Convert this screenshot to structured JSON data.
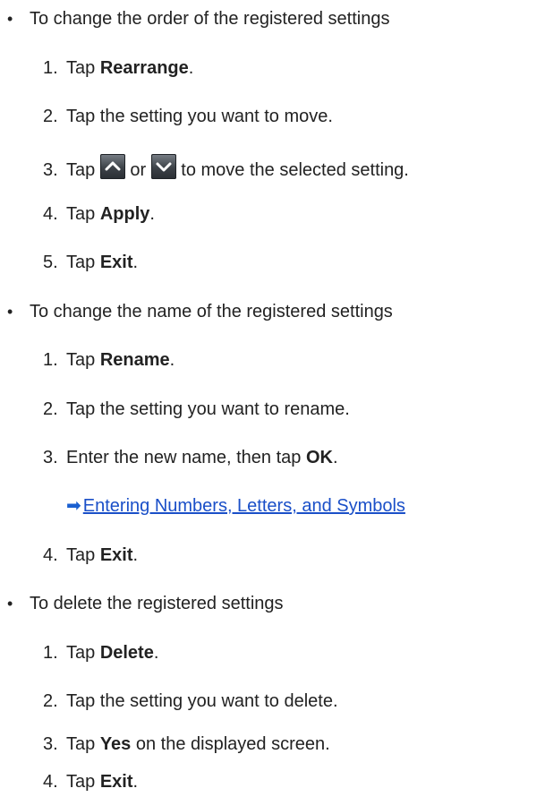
{
  "sections": [
    {
      "heading": "To change the order of the registered settings",
      "steps": [
        {
          "num": "1.",
          "pre": "Tap ",
          "bold": "Rearrange",
          "post": "."
        },
        {
          "num": "2.",
          "text": "Tap the setting you want to move."
        },
        {
          "num": "3.",
          "pre": "Tap ",
          "mid": " or ",
          "post": " to move the selected setting.",
          "icons": [
            "up-arrow-icon",
            "down-arrow-icon"
          ]
        },
        {
          "num": "4.",
          "pre": "Tap ",
          "bold": "Apply",
          "post": "."
        },
        {
          "num": "5.",
          "pre": "Tap ",
          "bold": "Exit",
          "post": "."
        }
      ]
    },
    {
      "heading": "To change the name of the registered settings",
      "steps": [
        {
          "num": "1.",
          "pre": "Tap ",
          "bold": "Rename",
          "post": "."
        },
        {
          "num": "2.",
          "text": "Tap the setting you want to rename."
        },
        {
          "num": "3.",
          "pre": "Enter the new name, then tap ",
          "bold": "OK",
          "post": "."
        },
        {
          "num": "4.",
          "pre": "Tap ",
          "bold": "Exit",
          "post": "."
        }
      ],
      "link": "Entering Numbers, Letters, and Symbols"
    },
    {
      "heading": "To delete the registered settings",
      "steps": [
        {
          "num": "1.",
          "pre": "Tap ",
          "bold": "Delete",
          "post": "."
        },
        {
          "num": "2.",
          "text": "Tap the setting you want to delete."
        },
        {
          "num": "3.",
          "pre": "Tap ",
          "bold": "Yes",
          "post": " on the displayed screen."
        },
        {
          "num": "4.",
          "pre": "Tap ",
          "bold": "Exit",
          "post": "."
        }
      ]
    }
  ],
  "colors": {
    "text": "#222222",
    "link": "#1a4fc8"
  },
  "bullet": "•",
  "link_arrow": "➡"
}
